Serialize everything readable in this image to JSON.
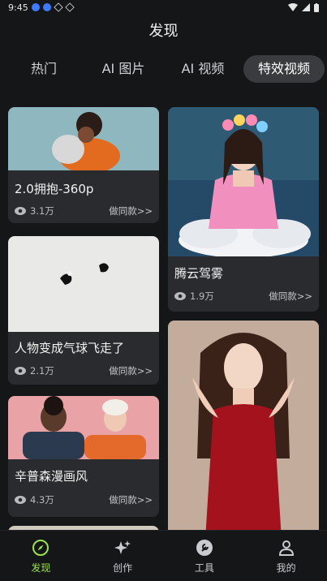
{
  "status": {
    "time": "9:45"
  },
  "page": {
    "title": "发现"
  },
  "tabs": [
    {
      "label": "热门"
    },
    {
      "label": "AI 图片"
    },
    {
      "label": "AI 视频"
    },
    {
      "label": "特效视频"
    }
  ],
  "active_tab": "特效视频",
  "cards": [
    {
      "title": "2.0拥抱-360p",
      "views": "3.1万",
      "action": "做同款>>"
    },
    {
      "title": "人物变成气球飞走了",
      "views": "2.1万",
      "action": "做同款>>"
    },
    {
      "title": "辛普森漫画风",
      "views": "4.3万",
      "action": "做同款>>"
    },
    {
      "title": "腾云驾雾",
      "views": "1.9万",
      "action": "做同款>>"
    }
  ],
  "nav": [
    {
      "label": "发现",
      "icon": "compass-icon"
    },
    {
      "label": "创作",
      "icon": "sparkle-icon"
    },
    {
      "label": "工具",
      "icon": "wrench-icon"
    },
    {
      "label": "我的",
      "icon": "person-icon"
    }
  ],
  "colors": {
    "accent": "#9be34a",
    "background": "#151618",
    "card": "#2a2b2e"
  }
}
